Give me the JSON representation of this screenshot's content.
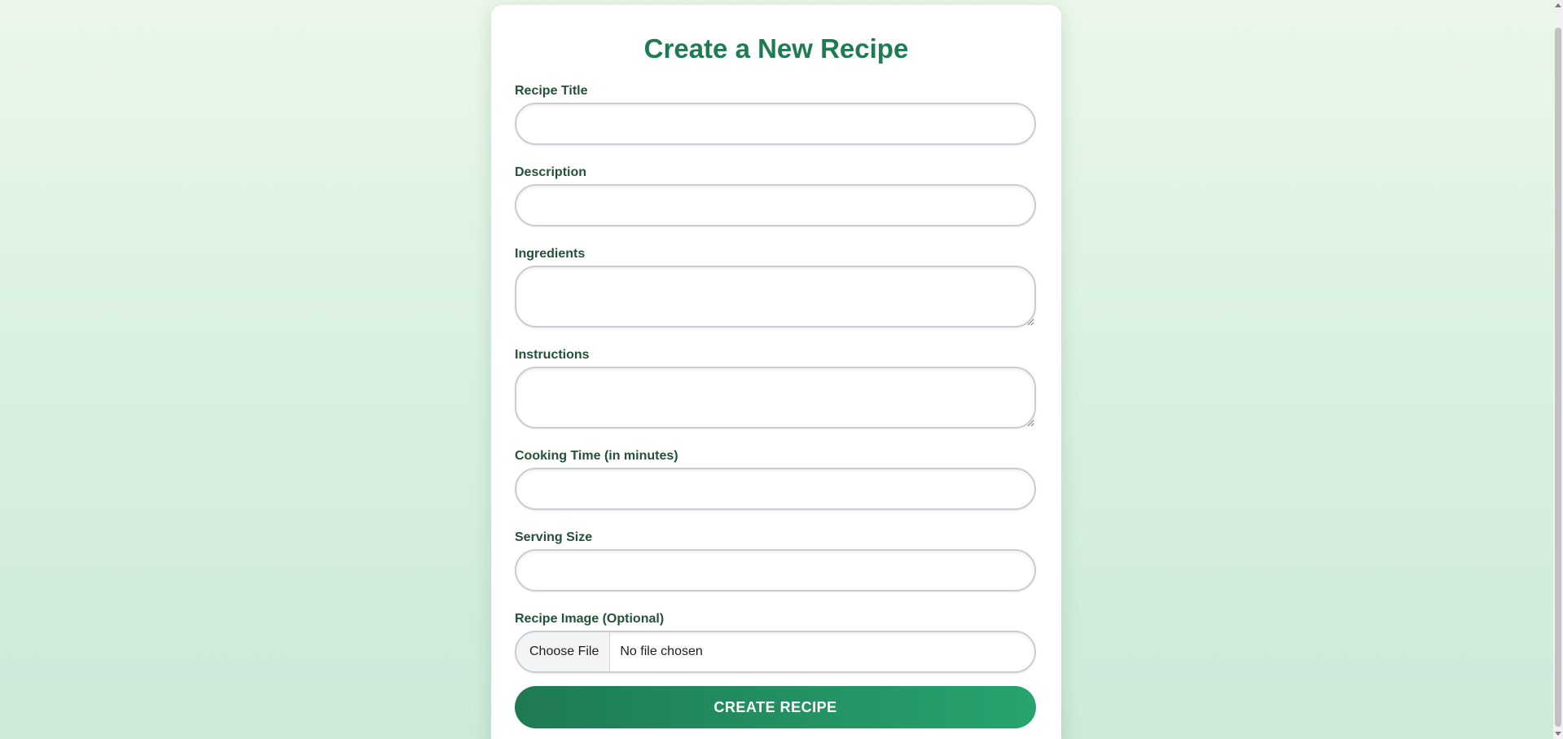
{
  "form": {
    "title": "Create a New Recipe",
    "fields": {
      "recipe_title": {
        "label": "Recipe Title",
        "value": "",
        "placeholder": ""
      },
      "description": {
        "label": "Description",
        "value": "",
        "placeholder": ""
      },
      "ingredients": {
        "label": "Ingredients",
        "value": "",
        "placeholder": ""
      },
      "instructions": {
        "label": "Instructions",
        "value": "",
        "placeholder": ""
      },
      "cooking_time": {
        "label": "Cooking Time (in minutes)",
        "value": "",
        "placeholder": ""
      },
      "serving_size": {
        "label": "Serving Size",
        "value": "",
        "placeholder": ""
      },
      "recipe_image": {
        "label": "Recipe Image (Optional)",
        "button_label": "Choose File",
        "status": "No file chosen"
      }
    },
    "submit_label": "CREATE RECIPE"
  },
  "colors": {
    "title": "#1e7b52",
    "label": "#24513a",
    "button_gradient_start": "#1f7a54",
    "button_gradient_end": "#27a46e",
    "background_top": "#eaf7e8",
    "background_bottom": "#cde9d8"
  }
}
